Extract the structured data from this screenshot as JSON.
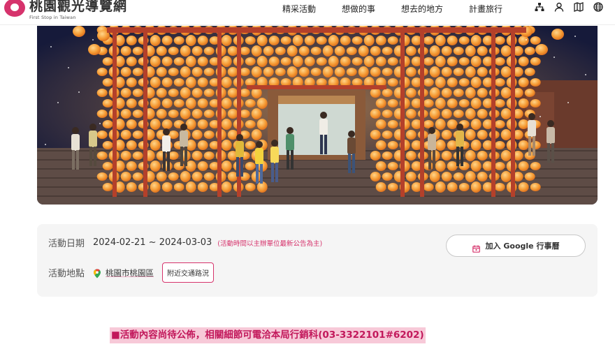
{
  "header": {
    "logo_title": "桃園觀光導覽網",
    "logo_subtitle": "First Stop in Taiwan",
    "nav": [
      {
        "label": "精采活動"
      },
      {
        "label": "想做的事"
      },
      {
        "label": "想去的地方"
      },
      {
        "label": "計畫旅行"
      }
    ],
    "icons": [
      "sitemap-icon",
      "user-icon",
      "map-icon",
      "globe-icon"
    ]
  },
  "hero": {
    "icon": "lantern-festival-illustration",
    "colors": {
      "sky": "#161a3a",
      "lantern": "#f28a2a",
      "frame": "#c94a2a",
      "floor": "#6b5750"
    }
  },
  "event": {
    "date_label": "活動日期",
    "date_value": "2024-02-21 ~ 2024-03-03",
    "date_note": "(活動時間以主辦單位最新公告為主)",
    "location_label": "活動地點",
    "location_icon": "map-pin-icon",
    "location_value": "桃園市桃園區",
    "traffic_button": "附近交通路況",
    "calendar_icon": "calendar-icon",
    "calendar_button": "加入 Google 行事曆"
  },
  "notice": {
    "text": "■活動內容尚待公佈，相關細節可電洽本局行銷科(03-3322101#6202)"
  },
  "colors": {
    "accent": "#d6336c",
    "notice_bg": "#f7c9d8",
    "notice_text": "#c2185b",
    "info_bg": "#f5f5f5"
  }
}
